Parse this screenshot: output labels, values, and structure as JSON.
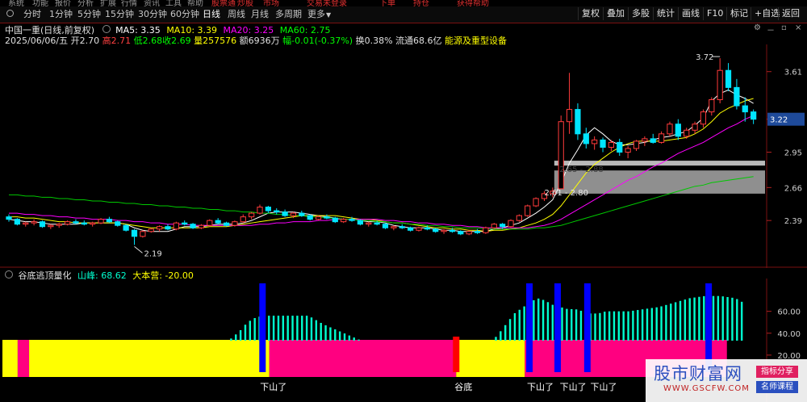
{
  "top_menu": [
    "系统",
    "功能",
    "报价",
    "分析",
    "扩展",
    "行情",
    "资讯",
    "工具",
    "帮助",
    "股票通",
    "炒股",
    "市场",
    "交易未登录",
    "下单",
    "持仓",
    "获得帮助"
  ],
  "toolbar": {
    "left_items": [
      "分时",
      "1分钟",
      "5分钟",
      "15分钟",
      "30分钟",
      "60分钟",
      "日线",
      "周线",
      "月线",
      "多周期",
      "更多"
    ],
    "active": "日线",
    "right_items": [
      "复权",
      "叠加",
      "多股",
      "统计",
      "画线",
      "F10",
      "标记",
      "+自选",
      "返回"
    ]
  },
  "stock": {
    "title": "中国一重(日线,前复权)",
    "ma5_label": "MA5: 3.35",
    "ma10_label": "MA10: 3.39",
    "ma20_label": "MA20: 3.25",
    "ma60_label": "MA60: 2.75",
    "date": "2025/06/06/五",
    "open_label": "开",
    "open": "2.70",
    "high_label": "高",
    "high": "2.71",
    "low_label": "低",
    "low": "2.68",
    "close_label": "收",
    "close": "2.69",
    "volume_label": "量",
    "volume": "257576",
    "amount_label": "额",
    "amount": "6936万",
    "change_label": "幅",
    "change": "-0.01(-0.37%)",
    "turnover_label": "换",
    "turnover": "0.38%",
    "float_label": "流通",
    "float_cap": "68.6亿",
    "sector": "能源及重型设备"
  },
  "colors": {
    "up": "#ff3b3b",
    "down": "#00e5ff",
    "ma5": "#ffffff",
    "ma10": "#ffff00",
    "ma20": "#ff00ff",
    "ma60": "#00c800",
    "indicator_bar": "#00ffd0",
    "zone_yellow": "#ffff00",
    "zone_pink": "#ff0080",
    "marker_blue": "#0000ff",
    "marker_red": "#ff0000"
  },
  "indicator": {
    "name": "谷底逃顶量化",
    "value_label": "山峰: 68.62",
    "value2_label": "大本营: -20.00",
    "y_ticks": [
      "60.00",
      "40.00",
      "20.00"
    ],
    "signal_labels": [
      "下山了",
      "谷底",
      "下山了",
      "下山了",
      "下山了"
    ]
  },
  "watermark": {
    "site": "股市财富网",
    "url": "WWW.GSCFW.COM",
    "tag1": "指标分享",
    "tag2": "名师课程"
  },
  "chart_data": {
    "type": "candlestick",
    "y_ticks": [
      2.39,
      2.66,
      2.95,
      3.22,
      3.61
    ],
    "current_price": "3.22",
    "annotations": {
      "high": "3.72",
      "low": "2.19",
      "gap_upper": "2.65 - 2.88",
      "gap_lower": "2.61 - 2.80"
    },
    "candles": [
      [
        2.42,
        2.44,
        2.38,
        2.4
      ],
      [
        2.4,
        2.41,
        2.35,
        2.36
      ],
      [
        2.36,
        2.38,
        2.34,
        2.37
      ],
      [
        2.37,
        2.4,
        2.35,
        2.38
      ],
      [
        2.38,
        2.39,
        2.33,
        2.34
      ],
      [
        2.34,
        2.36,
        2.32,
        2.35
      ],
      [
        2.35,
        2.37,
        2.33,
        2.36
      ],
      [
        2.36,
        2.39,
        2.35,
        2.38
      ],
      [
        2.38,
        2.4,
        2.36,
        2.37
      ],
      [
        2.37,
        2.39,
        2.35,
        2.36
      ],
      [
        2.36,
        2.38,
        2.34,
        2.37
      ],
      [
        2.37,
        2.41,
        2.36,
        2.4
      ],
      [
        2.4,
        2.42,
        2.37,
        2.38
      ],
      [
        2.38,
        2.39,
        2.34,
        2.35
      ],
      [
        2.35,
        2.36,
        2.3,
        2.31
      ],
      [
        2.31,
        2.32,
        2.19,
        2.26
      ],
      [
        2.26,
        2.31,
        2.25,
        2.3
      ],
      [
        2.3,
        2.33,
        2.29,
        2.32
      ],
      [
        2.32,
        2.35,
        2.3,
        2.34
      ],
      [
        2.34,
        2.36,
        2.31,
        2.32
      ],
      [
        2.32,
        2.38,
        2.31,
        2.37
      ],
      [
        2.37,
        2.39,
        2.35,
        2.36
      ],
      [
        2.36,
        2.37,
        2.32,
        2.33
      ],
      [
        2.33,
        2.36,
        2.32,
        2.35
      ],
      [
        2.35,
        2.4,
        2.34,
        2.39
      ],
      [
        2.39,
        2.41,
        2.36,
        2.37
      ],
      [
        2.37,
        2.38,
        2.34,
        2.35
      ],
      [
        2.35,
        2.39,
        2.34,
        2.38
      ],
      [
        2.38,
        2.44,
        2.37,
        2.42
      ],
      [
        2.42,
        2.46,
        2.4,
        2.45
      ],
      [
        2.45,
        2.52,
        2.44,
        2.5
      ],
      [
        2.5,
        2.51,
        2.45,
        2.47
      ],
      [
        2.47,
        2.49,
        2.44,
        2.46
      ],
      [
        2.46,
        2.48,
        2.42,
        2.43
      ],
      [
        2.43,
        2.46,
        2.41,
        2.45
      ],
      [
        2.45,
        2.47,
        2.42,
        2.43
      ],
      [
        2.43,
        2.44,
        2.39,
        2.4
      ],
      [
        2.4,
        2.43,
        2.39,
        2.42
      ],
      [
        2.42,
        2.44,
        2.4,
        2.41
      ],
      [
        2.41,
        2.42,
        2.37,
        2.38
      ],
      [
        2.38,
        2.41,
        2.37,
        2.4
      ],
      [
        2.4,
        2.42,
        2.38,
        2.39
      ],
      [
        2.39,
        2.4,
        2.35,
        2.36
      ],
      [
        2.36,
        2.38,
        2.34,
        2.37
      ],
      [
        2.37,
        2.39,
        2.35,
        2.36
      ],
      [
        2.36,
        2.37,
        2.32,
        2.33
      ],
      [
        2.33,
        2.35,
        2.31,
        2.34
      ],
      [
        2.34,
        2.36,
        2.32,
        2.33
      ],
      [
        2.33,
        2.34,
        2.3,
        2.31
      ],
      [
        2.31,
        2.34,
        2.3,
        2.33
      ],
      [
        2.33,
        2.35,
        2.31,
        2.32
      ],
      [
        2.32,
        2.33,
        2.29,
        2.3
      ],
      [
        2.3,
        2.32,
        2.28,
        2.31
      ],
      [
        2.31,
        2.33,
        2.29,
        2.3
      ],
      [
        2.3,
        2.31,
        2.27,
        2.28
      ],
      [
        2.28,
        2.31,
        2.27,
        2.3
      ],
      [
        2.3,
        2.32,
        2.28,
        2.29
      ],
      [
        2.29,
        2.34,
        2.28,
        2.33
      ],
      [
        2.33,
        2.37,
        2.32,
        2.36
      ],
      [
        2.36,
        2.37,
        2.32,
        2.34
      ],
      [
        2.34,
        2.4,
        2.33,
        2.39
      ],
      [
        2.39,
        2.44,
        2.38,
        2.43
      ],
      [
        2.43,
        2.52,
        2.42,
        2.51
      ],
      [
        2.51,
        2.58,
        2.5,
        2.57
      ],
      [
        2.57,
        2.63,
        2.55,
        2.61
      ],
      [
        2.61,
        2.66,
        2.58,
        2.63
      ],
      [
        2.65,
        3.25,
        2.88,
        3.2
      ],
      [
        3.2,
        3.6,
        3.1,
        3.3
      ],
      [
        3.3,
        3.35,
        3.05,
        3.1
      ],
      [
        3.1,
        3.15,
        2.98,
        3.02
      ],
      [
        3.02,
        3.08,
        2.97,
        3.05
      ],
      [
        3.05,
        3.07,
        2.95,
        2.99
      ],
      [
        2.99,
        3.05,
        2.96,
        3.03
      ],
      [
        3.03,
        3.06,
        2.92,
        2.95
      ],
      [
        2.95,
        3.0,
        2.9,
        2.98
      ],
      [
        2.98,
        3.05,
        2.96,
        3.04
      ],
      [
        3.04,
        3.08,
        3.0,
        3.06
      ],
      [
        3.06,
        3.1,
        3.02,
        3.03
      ],
      [
        3.03,
        3.12,
        3.02,
        3.1
      ],
      [
        3.1,
        3.2,
        3.08,
        3.18
      ],
      [
        3.18,
        3.22,
        3.05,
        3.08
      ],
      [
        3.08,
        3.15,
        3.06,
        3.13
      ],
      [
        3.13,
        3.2,
        3.1,
        3.18
      ],
      [
        3.18,
        3.3,
        3.15,
        3.28
      ],
      [
        3.28,
        3.4,
        3.25,
        3.38
      ],
      [
        3.38,
        3.72,
        3.35,
        3.62
      ],
      [
        3.62,
        3.68,
        3.45,
        3.48
      ],
      [
        3.48,
        3.55,
        3.3,
        3.33
      ],
      [
        3.33,
        3.4,
        3.2,
        3.28
      ],
      [
        3.28,
        3.3,
        3.18,
        3.22
      ]
    ],
    "ma_lines": {
      "MA5": [
        2.4,
        2.39,
        2.38,
        2.38,
        2.37,
        2.36,
        2.36,
        2.36,
        2.36,
        2.37,
        2.37,
        2.37,
        2.37,
        2.37,
        2.36,
        2.33,
        2.31,
        2.3,
        2.3,
        2.3,
        2.32,
        2.34,
        2.34,
        2.34,
        2.35,
        2.36,
        2.36,
        2.36,
        2.37,
        2.39,
        2.42,
        2.45,
        2.46,
        2.46,
        2.46,
        2.45,
        2.44,
        2.43,
        2.42,
        2.41,
        2.4,
        2.4,
        2.39,
        2.38,
        2.38,
        2.37,
        2.35,
        2.34,
        2.33,
        2.33,
        2.33,
        2.32,
        2.31,
        2.31,
        2.3,
        2.3,
        2.3,
        2.3,
        2.32,
        2.33,
        2.35,
        2.37,
        2.41,
        2.45,
        2.5,
        2.56,
        2.7,
        2.86,
        2.97,
        3.09,
        3.15,
        3.1,
        3.04,
        3.01,
        3.01,
        3.02,
        3.03,
        3.05,
        3.07,
        3.08,
        3.1,
        3.12,
        3.17,
        3.23,
        3.37,
        3.43,
        3.46,
        3.42,
        3.39,
        3.35
      ],
      "MA10": [
        2.42,
        2.42,
        2.41,
        2.41,
        2.4,
        2.39,
        2.38,
        2.38,
        2.37,
        2.37,
        2.37,
        2.37,
        2.37,
        2.37,
        2.36,
        2.35,
        2.34,
        2.33,
        2.33,
        2.33,
        2.33,
        2.33,
        2.33,
        2.33,
        2.34,
        2.34,
        2.34,
        2.35,
        2.36,
        2.37,
        2.38,
        2.39,
        2.4,
        2.41,
        2.42,
        2.43,
        2.43,
        2.43,
        2.43,
        2.43,
        2.42,
        2.41,
        2.4,
        2.4,
        2.39,
        2.38,
        2.37,
        2.37,
        2.36,
        2.35,
        2.34,
        2.33,
        2.33,
        2.32,
        2.32,
        2.31,
        2.31,
        2.3,
        2.31,
        2.31,
        2.32,
        2.33,
        2.35,
        2.37,
        2.4,
        2.44,
        2.51,
        2.6,
        2.69,
        2.78,
        2.85,
        2.9,
        2.95,
        2.99,
        3.02,
        3.04,
        3.04,
        3.04,
        3.04,
        3.05,
        3.06,
        3.07,
        3.1,
        3.14,
        3.2,
        3.27,
        3.31,
        3.34,
        3.37,
        3.39
      ],
      "MA20": [
        2.45,
        2.45,
        2.44,
        2.44,
        2.43,
        2.43,
        2.42,
        2.42,
        2.41,
        2.41,
        2.4,
        2.4,
        2.4,
        2.39,
        2.39,
        2.38,
        2.38,
        2.37,
        2.37,
        2.36,
        2.36,
        2.36,
        2.35,
        2.35,
        2.35,
        2.35,
        2.35,
        2.35,
        2.35,
        2.35,
        2.36,
        2.36,
        2.37,
        2.37,
        2.38,
        2.38,
        2.38,
        2.39,
        2.39,
        2.4,
        2.4,
        2.4,
        2.4,
        2.4,
        2.4,
        2.39,
        2.39,
        2.38,
        2.38,
        2.37,
        2.37,
        2.36,
        2.36,
        2.35,
        2.35,
        2.34,
        2.34,
        2.33,
        2.33,
        2.33,
        2.33,
        2.33,
        2.33,
        2.34,
        2.35,
        2.37,
        2.4,
        2.44,
        2.48,
        2.52,
        2.56,
        2.6,
        2.64,
        2.68,
        2.72,
        2.75,
        2.79,
        2.83,
        2.86,
        2.9,
        2.94,
        2.97,
        3.0,
        3.03,
        3.07,
        3.11,
        3.15,
        3.18,
        3.22,
        3.25
      ],
      "MA60": [
        2.6,
        2.6,
        2.59,
        2.59,
        2.58,
        2.58,
        2.57,
        2.57,
        2.56,
        2.56,
        2.55,
        2.55,
        2.54,
        2.54,
        2.53,
        2.53,
        2.52,
        2.52,
        2.51,
        2.51,
        2.5,
        2.5,
        2.49,
        2.49,
        2.48,
        2.48,
        2.47,
        2.47,
        2.46,
        2.46,
        2.45,
        2.45,
        2.44,
        2.44,
        2.43,
        2.43,
        2.42,
        2.42,
        2.41,
        2.41,
        2.4,
        2.4,
        2.39,
        2.39,
        2.38,
        2.38,
        2.37,
        2.37,
        2.36,
        2.36,
        2.35,
        2.35,
        2.34,
        2.34,
        2.33,
        2.33,
        2.33,
        2.32,
        2.32,
        2.32,
        2.32,
        2.32,
        2.32,
        2.33,
        2.33,
        2.34,
        2.35,
        2.37,
        2.39,
        2.41,
        2.43,
        2.45,
        2.47,
        2.49,
        2.51,
        2.53,
        2.55,
        2.57,
        2.59,
        2.61,
        2.63,
        2.65,
        2.67,
        2.68,
        2.7,
        2.71,
        2.72,
        2.73,
        2.74,
        2.75
      ]
    },
    "gap_zones": [
      [
        2.84,
        2.88
      ],
      [
        2.61,
        2.8
      ]
    ],
    "indicator_values": [
      0,
      0,
      0,
      0,
      0,
      0,
      0,
      0,
      0,
      0,
      0,
      0,
      0,
      0,
      0,
      0,
      0,
      0,
      0,
      0,
      0,
      0,
      0,
      0,
      0,
      0,
      0,
      0,
      0,
      0,
      0,
      0,
      0,
      0,
      0,
      0,
      0,
      0,
      0,
      0,
      0,
      0,
      0,
      0,
      0,
      0,
      0,
      0,
      0,
      0,
      0,
      0,
      0,
      0,
      0,
      0,
      0,
      0,
      0,
      0,
      0,
      0,
      0,
      0,
      0,
      0,
      0,
      0,
      0,
      0,
      0,
      0,
      0,
      0,
      0,
      0,
      0,
      0,
      0,
      0,
      0,
      0,
      0,
      0,
      0,
      0,
      0,
      0,
      0,
      0
    ],
    "indicator_curve": [
      [
        0.28,
        0
      ],
      [
        0.29,
        30
      ],
      [
        0.31,
        42
      ],
      [
        0.32,
        50
      ],
      [
        0.33,
        54
      ],
      [
        0.34,
        56
      ],
      [
        0.35,
        56
      ],
      [
        0.37,
        56
      ],
      [
        0.39,
        56
      ],
      [
        0.4,
        56
      ],
      [
        0.41,
        52
      ],
      [
        0.42,
        48
      ],
      [
        0.44,
        42
      ],
      [
        0.46,
        36
      ],
      [
        0.48,
        30
      ],
      [
        0.49,
        27
      ],
      [
        0.5,
        24
      ],
      [
        0.51,
        22
      ],
      [
        0.52,
        20
      ],
      [
        0.63,
        24
      ],
      [
        0.65,
        40
      ],
      [
        0.67,
        58
      ],
      [
        0.69,
        68
      ],
      [
        0.7,
        72
      ],
      [
        0.71,
        70
      ],
      [
        0.72,
        66
      ],
      [
        0.73,
        64
      ],
      [
        0.74,
        62
      ],
      [
        0.75,
        62
      ],
      [
        0.76,
        60
      ],
      [
        0.77,
        58
      ],
      [
        0.78,
        58
      ],
      [
        0.79,
        60
      ],
      [
        0.8,
        60
      ],
      [
        0.82,
        60
      ],
      [
        0.84,
        62
      ],
      [
        0.86,
        64
      ],
      [
        0.88,
        68
      ],
      [
        0.9,
        72
      ],
      [
        0.92,
        74
      ],
      [
        0.94,
        74
      ],
      [
        0.96,
        72
      ],
      [
        0.97,
        68
      ]
    ],
    "zones": [
      {
        "from": 0.0,
        "to": 0.02,
        "color": "yellow"
      },
      {
        "from": 0.02,
        "to": 0.035,
        "color": "pink"
      },
      {
        "from": 0.035,
        "to": 0.35,
        "color": "yellow"
      },
      {
        "from": 0.35,
        "to": 0.595,
        "color": "pink"
      },
      {
        "from": 0.595,
        "to": 0.685,
        "color": "yellow"
      },
      {
        "from": 0.685,
        "to": 0.95,
        "color": "pink"
      }
    ],
    "markers": [
      {
        "at": 0.34,
        "color": "blue",
        "tall": true
      },
      {
        "at": 0.595,
        "color": "red",
        "tall": false
      },
      {
        "at": 0.69,
        "color": "blue",
        "tall": true
      },
      {
        "at": 0.727,
        "color": "blue",
        "tall": true
      },
      {
        "at": 0.766,
        "color": "blue",
        "tall": true
      },
      {
        "at": 0.925,
        "color": "blue",
        "tall": true
      }
    ]
  }
}
